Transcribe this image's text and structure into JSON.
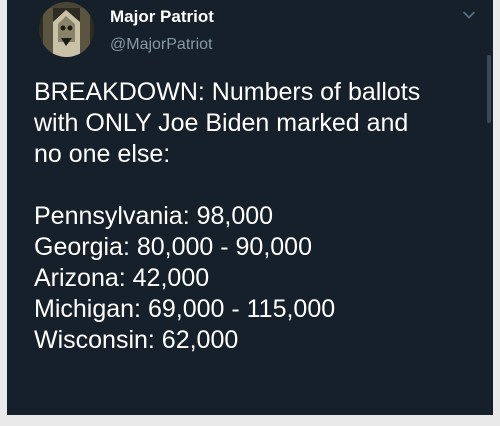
{
  "tweet": {
    "author": {
      "display_name": "Major Patriot",
      "handle": "@MajorPatriot",
      "avatar_icon": "eagle-avatar-icon"
    },
    "menu_icon": "chevron-down-icon",
    "headline_lines": [
      "BREAKDOWN:  Numbers of ballots",
      "with ONLY Joe Biden marked and",
      "no one else:"
    ],
    "states": [
      {
        "line": "Pennsylvania:  98,000"
      },
      {
        "line": "Georgia:  80,000 - 90,000"
      },
      {
        "line": "Arizona:  42,000"
      },
      {
        "line": "Michigan:  69,000 - 115,000"
      },
      {
        "line": "Wisconsin:  62,000"
      }
    ]
  },
  "colors": {
    "background": "#15202b",
    "text": "#ffffff",
    "muted": "#8899a6",
    "frame": "#e9e9e9"
  }
}
